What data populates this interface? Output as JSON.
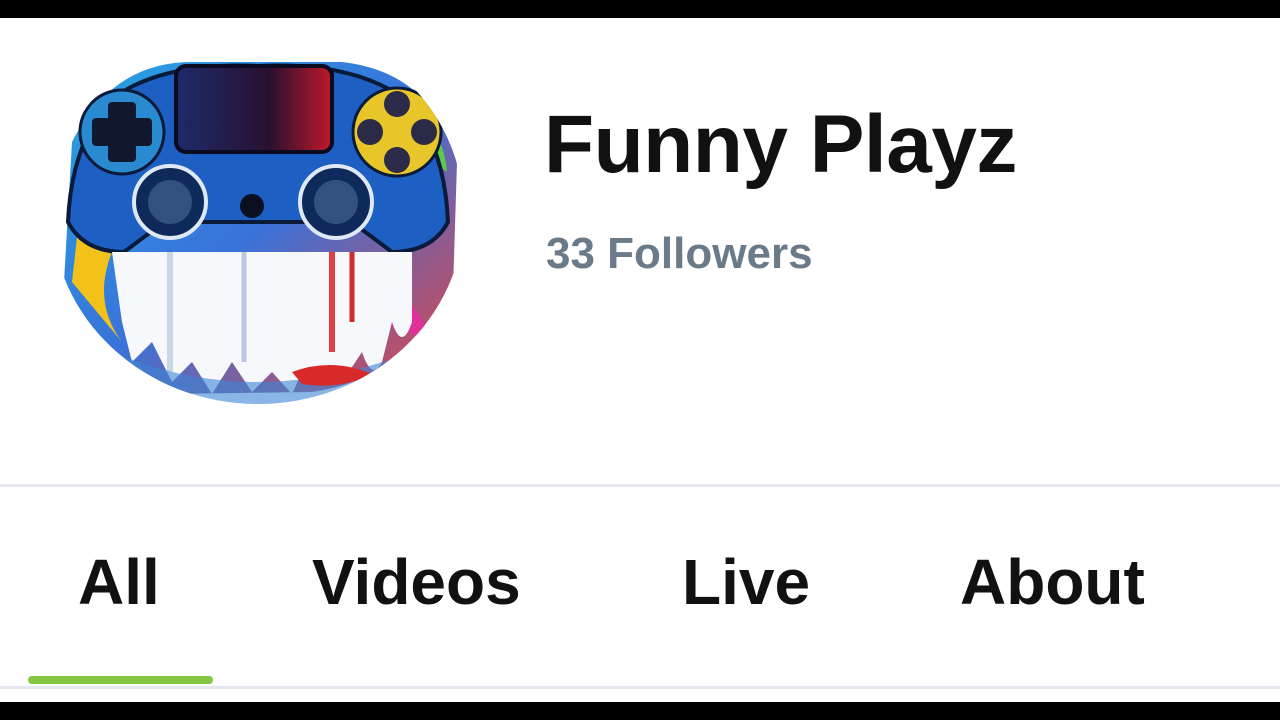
{
  "channel": {
    "name": "Funny Playz",
    "followers_text": "33 Followers",
    "avatar": "painted-game-controller-image"
  },
  "tabs": [
    {
      "label": "All",
      "active": true
    },
    {
      "label": "Videos",
      "active": false
    },
    {
      "label": "Live",
      "active": false
    },
    {
      "label": "About",
      "active": false
    }
  ],
  "colors": {
    "active_tab_indicator": "#85c742",
    "followers_text": "#6b7a89",
    "divider": "#e4e8ee"
  }
}
